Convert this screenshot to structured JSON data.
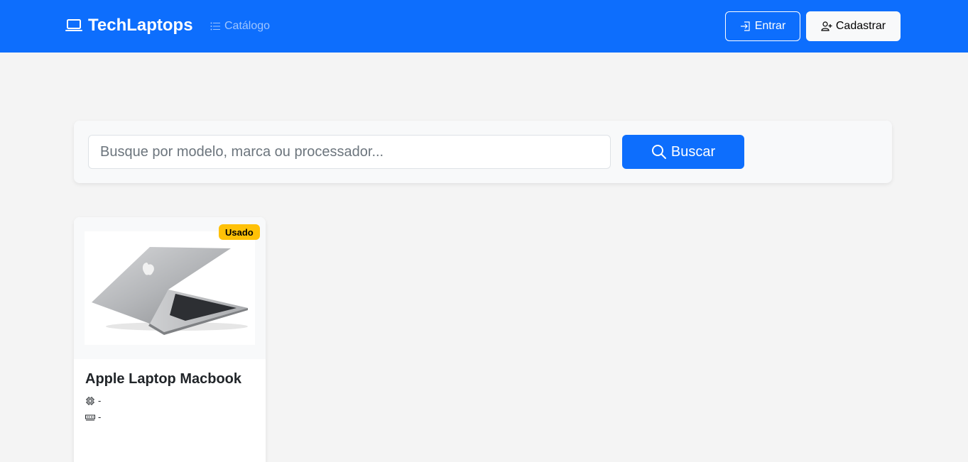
{
  "header": {
    "brand": "TechLaptops",
    "brand_icon": "laptop-icon",
    "catalog_link": "Catálogo",
    "catalog_icon": "list-icon",
    "login_label": "Entrar",
    "login_icon": "box-arrow-in-right-icon",
    "signup_label": "Cadastrar",
    "signup_icon": "person-plus-icon",
    "bg_color": "#0d6efd"
  },
  "search": {
    "placeholder": "Busque por modelo, marca ou processador...",
    "button_label": "Buscar",
    "button_icon": "search-icon"
  },
  "products": [
    {
      "title": "Apple Laptop Macbook",
      "badge": "Usado",
      "badge_color": "#ffc107",
      "image": "macbook-laptop-image",
      "cpu_icon": "cpu-icon",
      "cpu": "-",
      "ram_icon": "memory-icon",
      "ram": "-"
    }
  ]
}
